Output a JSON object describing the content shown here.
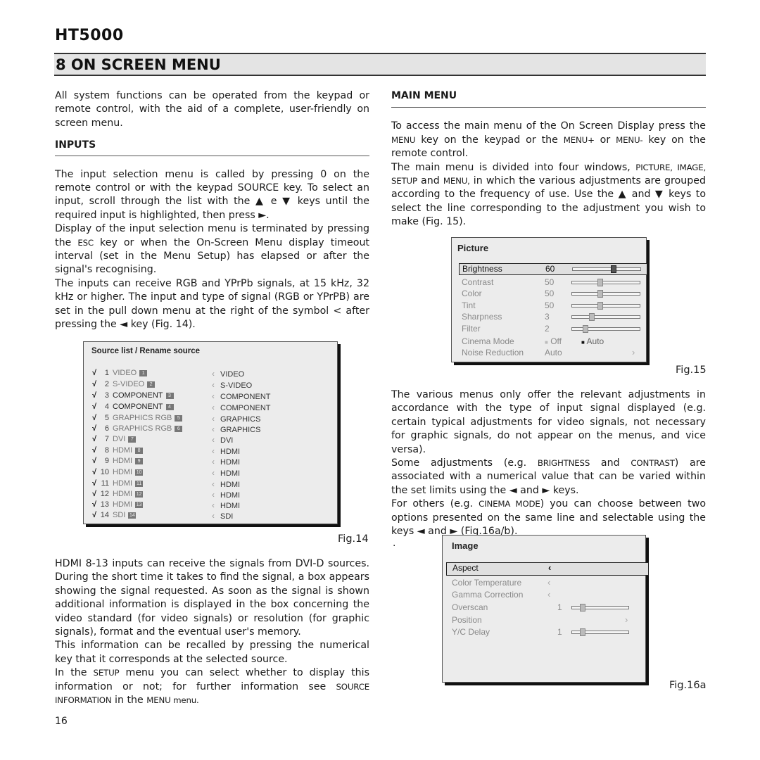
{
  "header": {
    "brand": "HT5000",
    "section_title": "8  ON SCREEN MENU"
  },
  "left": {
    "intro": "All system functions can be operated from the keypad or remote control, with the aid of a complete, user-friendly on screen menu.",
    "inputs_heading": "INPUTS",
    "p1": "The input selection menu is called by pressing 0 on the remote control or with the keypad SOURCE key. To select an input, scroll through the list with the ▲ e ▼ keys until the required input is highlighted, then press ►.",
    "p2_a": "Display of the input selection menu is terminated by pressing the ",
    "p2_key": "ESC",
    "p2_b": " key or when the On-Screen Menu display timeout interval (set in the Menu Setup) has elapsed or after the signal's recognising.",
    "p3": "The inputs can receive RGB and YPrPb signals, at 15 kHz, 32 kHz or higher. The input and type of signal (RGB or YPrPB) are set in the pull down menu at the right of the symbol < after pressing the ◄ key (Fig. 14).",
    "fig_label": "Fig.14",
    "p4": "HDMI 8-13 inputs can receive the signals from DVI-D sources. During the short time it takes to find the signal, a box appears showing the signal requested. As soon as the signal is shown additional information is displayed in the box concerning the video standard (for video signals) or resolution (for graphic signals), format and the eventual user's memory.",
    "p5": "This information can be recalled  by pressing the numerical key that it corresponds at the selected source.",
    "p6_a": "In the ",
    "p6_setup": "SETUP",
    "p6_b": "  menu you can select whether to display this information or not; for further information  see ",
    "p6_srcinfo": "SOURCE INFORMATION",
    "p6_c": "  in the ",
    "p6_menu": "MENU",
    "p6_d": "  menu.",
    "page_number": "16"
  },
  "source_list": {
    "title": "Source list / Rename source",
    "check_icon": "√",
    "rename_icon": "‹",
    "rows": [
      {
        "num": "1",
        "name": "VIDEO",
        "badge": "1",
        "rename": "VIDEO",
        "active": false
      },
      {
        "num": "2",
        "name": "S-VIDEO",
        "badge": "2",
        "rename": "S-VIDEO",
        "active": false
      },
      {
        "num": "3",
        "name": "COMPONENT",
        "badge": "3",
        "rename": "COMPONENT",
        "active": true
      },
      {
        "num": "4",
        "name": "COMPONENT",
        "badge": "4",
        "rename": "COMPONENT",
        "active": true
      },
      {
        "num": "5",
        "name": "GRAPHICS RGB",
        "badge": "5",
        "rename": "GRAPHICS",
        "active": false
      },
      {
        "num": "6",
        "name": "GRAPHICS RGB",
        "badge": "6",
        "rename": "GRAPHICS",
        "active": false
      },
      {
        "num": "7",
        "name": "DVI",
        "badge": "7",
        "rename": "DVI",
        "active": false
      },
      {
        "num": "8",
        "name": "HDMI",
        "badge": "8",
        "rename": "HDMI",
        "active": false
      },
      {
        "num": "9",
        "name": "HDMI",
        "badge": "9",
        "rename": "HDMI",
        "active": false
      },
      {
        "num": "10",
        "name": "HDMI",
        "badge": "10",
        "rename": "HDMI",
        "active": false
      },
      {
        "num": "11",
        "name": "HDMI",
        "badge": "11",
        "rename": "HDMI",
        "active": false
      },
      {
        "num": "12",
        "name": "HDMI",
        "badge": "12",
        "rename": "HDMI",
        "active": false
      },
      {
        "num": "13",
        "name": "HDMI",
        "badge": "13",
        "rename": "HDMI",
        "active": false
      },
      {
        "num": "14",
        "name": "SDI",
        "badge": "14",
        "rename": "SDI",
        "active": false
      }
    ]
  },
  "right": {
    "main_menu_heading": "MAIN MENU",
    "p1_a": "To access the main menu of the On Screen Display press the ",
    "p1_menu": "MENU",
    "p1_b": " key on the keypad or the ",
    "p1_menuplus": "MENU+",
    "p1_c": " or ",
    "p1_menuminus": "MENU-",
    "p1_d": " key on the remote control.",
    "p2_a": "The main menu is divided into four windows, ",
    "p2_windows": "PICTURE, IMAGE, SETUP",
    "p2_and": " and ",
    "p2_menu": "MENU,",
    "p2_b": " in which the various adjustments are grouped according to the frequency of use. Use the ▲ and ▼ keys to select the line corresponding to the adjustment you wish to make (Fig. 15).",
    "fig15_label": "Fig.15",
    "p3": "The various menus only offer the relevant adjustments in accordance with the type of input signal displayed (e.g. certain typical adjustments for video signals, not necessary for graphic signals, do not appear on the menus, and vice versa).",
    "p4_a": "Some adjustments (e.g. ",
    "p4_bright": "BRIGHTNESS",
    "p4_and": " and ",
    "p4_contrast": "CONTRAST",
    "p4_b": ") are associated with a numerical value that can be varied within the set limits using the ◄ and ► keys.",
    "p5_a": "For others (e.g. ",
    "p5_cinema": "CINEMA MODE",
    "p5_b": ") you can choose between two options presented on the same line and selectable using the keys ◄ and ► (Fig.16a/b).",
    "stray_dot": ".",
    "fig16a_label": "Fig.16a"
  },
  "picture_menu": {
    "title": "Picture",
    "rows": [
      {
        "label": "Brightness",
        "value": "60",
        "slider": 0.6,
        "selected": true
      },
      {
        "label": "Contrast",
        "value": "50",
        "slider": 0.4
      },
      {
        "label": "Color",
        "value": "50",
        "slider": 0.4
      },
      {
        "label": "Tint",
        "value": "50",
        "slider": 0.4
      },
      {
        "label": "Sharpness",
        "value": "3",
        "slider": 0.27
      },
      {
        "label": "Filter",
        "value": "2",
        "slider": 0.17
      }
    ],
    "cinema_mode": {
      "label": "Cinema Mode",
      "option_off": "Off",
      "option_auto": "Auto",
      "selected": "Auto"
    },
    "noise_reduction": {
      "label": "Noise Reduction",
      "value": "Auto",
      "chevron": "›"
    }
  },
  "image_menu": {
    "title": "Image",
    "rows": [
      {
        "label": "Aspect",
        "chevron": "‹",
        "selected": true
      },
      {
        "label": "Color  Temperature",
        "chevron": "‹"
      },
      {
        "label": "Gamma Correction",
        "chevron": "‹"
      },
      {
        "label": "Overscan",
        "value": "1",
        "slider": 0.15
      },
      {
        "label": "Position",
        "chevron": "›"
      },
      {
        "label": "Y/C Delay",
        "value": "1",
        "slider": 0.15
      }
    ]
  }
}
